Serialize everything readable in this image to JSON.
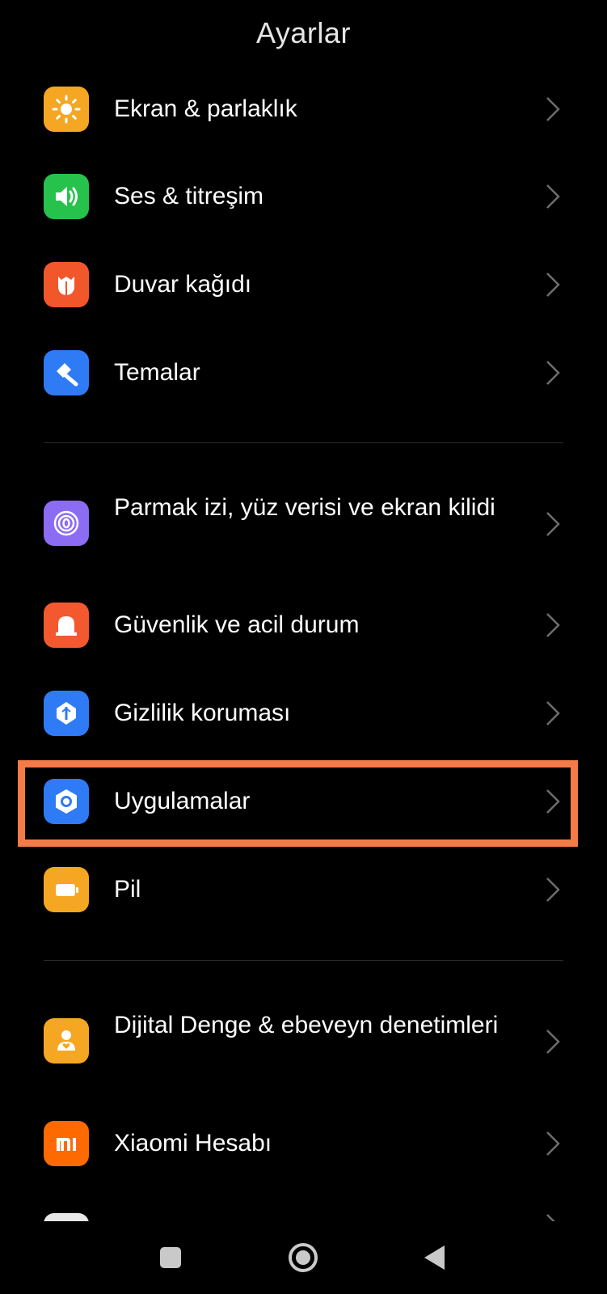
{
  "header": {
    "title": "Ayarlar"
  },
  "items": [
    {
      "label": "Ekran & parlaklık",
      "icon": "sun-icon",
      "color": "#f5a623"
    },
    {
      "label": "Ses & titreşim",
      "icon": "speaker-icon",
      "color": "#27c24c"
    },
    {
      "label": "Duvar kağıdı",
      "icon": "tulip-icon",
      "color": "#f2572b"
    },
    {
      "label": "Temalar",
      "icon": "paint-brush-icon",
      "color": "#2f7bf6"
    },
    {
      "label": "Parmak izi, yüz verisi ve ekran kilidi",
      "icon": "fingerprint-icon",
      "color": "#8c6cf2"
    },
    {
      "label": "Güvenlik ve acil durum",
      "icon": "emergency-light-icon",
      "color": "#f4582f"
    },
    {
      "label": "Gizlilik koruması",
      "icon": "privacy-shield-icon",
      "color": "#2f7bf6"
    },
    {
      "label": "Uygulamalar",
      "icon": "apps-hexagon-icon",
      "color": "#2f7bf6"
    },
    {
      "label": "Pil",
      "icon": "battery-icon",
      "color": "#f5a623"
    },
    {
      "label": "Dijital Denge & ebeveyn denetimleri",
      "icon": "digital-wellbeing-icon",
      "color": "#f5a623"
    },
    {
      "label": "Xiaomi Hesabı",
      "icon": "mi-logo-icon",
      "color": "#ff6a00"
    }
  ],
  "highlight_color": "#f47a47",
  "navbar": {
    "buttons": [
      "recents-icon",
      "home-icon",
      "back-icon"
    ]
  }
}
